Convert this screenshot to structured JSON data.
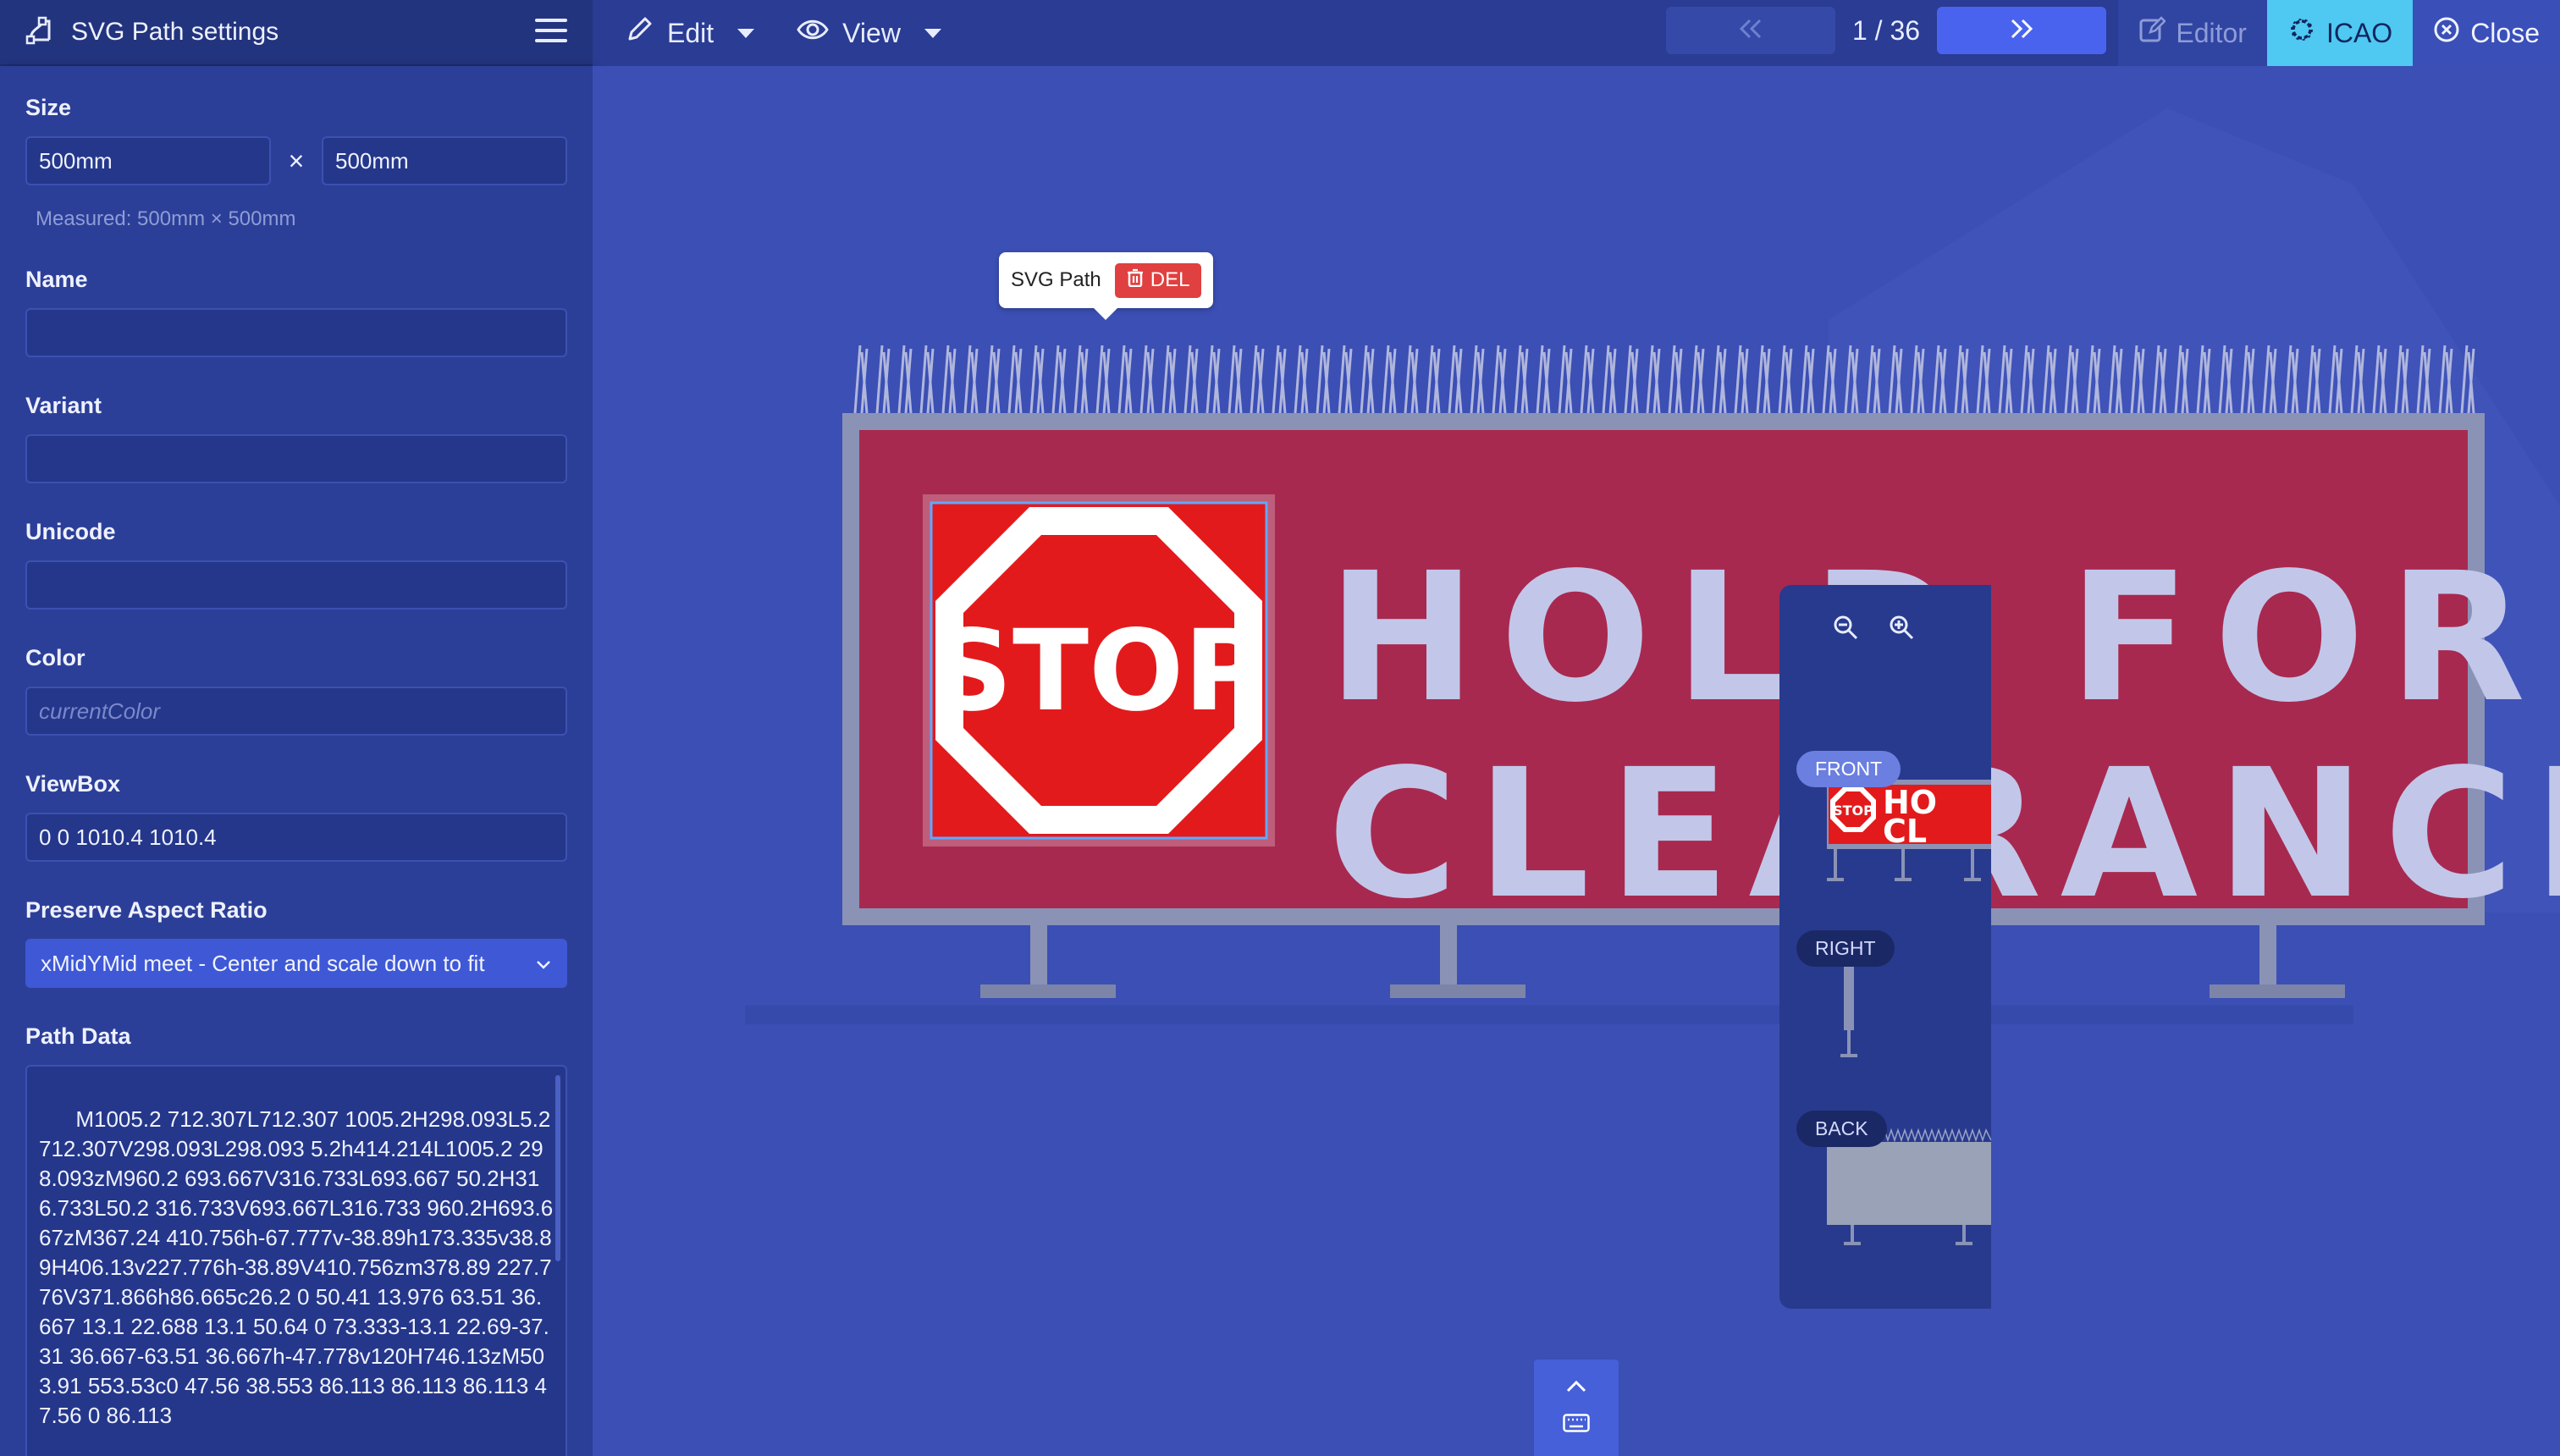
{
  "app": {
    "panel_title": "SVG Path settings",
    "menu": {
      "edit_label": "Edit",
      "view_label": "View"
    },
    "pager": {
      "label": "1 / 36"
    },
    "right": {
      "editor_label": "Editor",
      "icao_label": "ICAO",
      "close_label": "Close"
    }
  },
  "settings": {
    "size_label": "Size",
    "width_value": "500mm",
    "height_value": "500mm",
    "times_symbol": "×",
    "measured_text": "Measured: 500mm × 500mm",
    "name_label": "Name",
    "name_value": "",
    "variant_label": "Variant",
    "variant_value": "",
    "unicode_label": "Unicode",
    "unicode_value": "",
    "color_label": "Color",
    "color_placeholder": "currentColor",
    "viewbox_label": "ViewBox",
    "viewbox_value": "0 0 1010.4 1010.4",
    "par_label": "Preserve Aspect Ratio",
    "par_value": "xMidYMid meet - Center and scale down to fit",
    "path_label": "Path Data",
    "path_value": "M1005.2 712.307L712.307 1005.2H298.093L5.2 712.307V298.093L298.093 5.2h414.214L1005.2 298.093zM960.2 693.667V316.733L693.667 50.2H316.733L50.2 316.733V693.667L316.733 960.2H693.667zM367.24 410.756h-67.777v-38.89h173.335v38.89H406.13v227.776h-38.89V410.756zm378.89 227.776V371.866h86.665c26.2 0 50.41 13.976 63.51 36.667 13.1 22.688 13.1 50.64 0 73.333-13.1 22.69-37.31 36.667-63.51 36.667h-47.778v120H746.13zM503.91 553.53c0 47.56 38.553 86.113 86.113 86.113 47.56 0 86.113"
  },
  "canvas": {
    "tooltip_label": "SVG Path",
    "delete_label": "DEL",
    "sign": {
      "stop_text": "STOP",
      "line1": "HOLD FOR",
      "line2": "CLEARANCE"
    }
  },
  "viewpanel": {
    "front_label": "FRONT",
    "right_label": "RIGHT",
    "back_label": "BACK",
    "thumb_stop": "STOP",
    "thumb_text_1": "HO",
    "thumb_text_2": "CL"
  },
  "colors": {
    "background": "#3b4fb4",
    "panel": "#2c3f98",
    "sign_red": "#a8294f",
    "stop_red": "#e31a1c",
    "letters": "#c2c7ea",
    "accent": "#4a63ef",
    "icao": "#4fc8f2",
    "delete": "#e0403f"
  },
  "icons": [
    "path-tool-icon",
    "hamburger-icon",
    "pencil-icon",
    "eye-icon",
    "double-chevron-left-icon",
    "double-chevron-right-icon",
    "editor-icon",
    "gear-icon",
    "close-circle-icon",
    "trash-icon",
    "zoom-out-icon",
    "zoom-in-icon",
    "chevron-up-icon",
    "keyboard-icon",
    "chevron-down-icon"
  ]
}
